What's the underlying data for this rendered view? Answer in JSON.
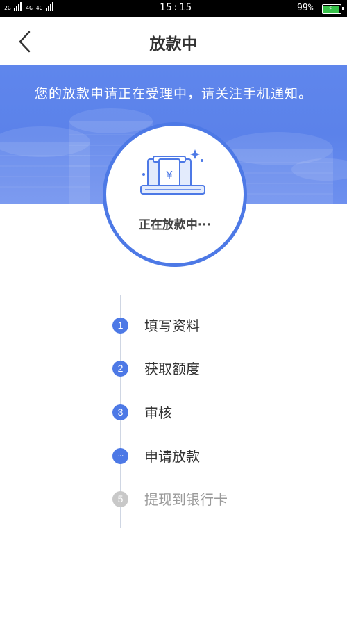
{
  "status_bar": {
    "network_labels": [
      "2G",
      "4G 4G"
    ],
    "time": "15:15",
    "battery": "99%",
    "battery_level": 0.99
  },
  "nav": {
    "title": "放款中",
    "back_icon": "chevron-left-icon"
  },
  "banner": {
    "message": "您的放款申请正在受理中，请关注手机通知。"
  },
  "status_card": {
    "icon": "atm-cash-icon",
    "currency_symbol": "¥",
    "status_text": "正在放款中···"
  },
  "steps": [
    {
      "marker": "1",
      "label": "填写资料",
      "state": "done"
    },
    {
      "marker": "2",
      "label": "获取额度",
      "state": "done"
    },
    {
      "marker": "3",
      "label": "审核",
      "state": "done"
    },
    {
      "marker": "···",
      "label": "申请放款",
      "state": "active"
    },
    {
      "marker": "5",
      "label": "提现到银行卡",
      "state": "pending"
    }
  ],
  "colors": {
    "accent": "#4d79e6",
    "banner": "#5f86ec",
    "pending": "#c8c8c8"
  }
}
